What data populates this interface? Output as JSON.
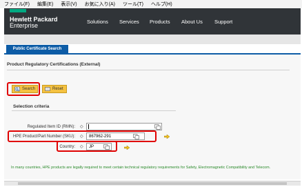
{
  "menu": [
    "ファイル(F)",
    "編集(E)",
    "表示(V)",
    "お気に入り(A)",
    "ツール(T)",
    "ヘルプ(H)"
  ],
  "brand": {
    "line1": "Hewlett Packard",
    "line2": "Enterprise",
    "accent": "#01a982"
  },
  "nav": [
    "Solutions",
    "Services",
    "Products",
    "About Us",
    "Support"
  ],
  "tab_label": "Public Certificate Search",
  "section_title": "Product Regulatory Certifications (External)",
  "buttons": {
    "search": "Search",
    "reset": "Reset"
  },
  "criteria_title": "Selection criteria",
  "fields": [
    {
      "label": "Regulated Item ID (RMN):",
      "value": ""
    },
    {
      "label": "HPE Product/Part Number (SKU):",
      "value": "867962-291"
    },
    {
      "label": "Country:",
      "value": "JP"
    }
  ],
  "footer_note": "In many countries, HPE products are legally required to meet certain technical regulatory requirements for Safety, Electromagnetic Compatibility and Telecom.",
  "colors": {
    "highlight": "#e00000",
    "tab": "#0d5ca6",
    "button": "#f5c241",
    "header": "#303438"
  }
}
